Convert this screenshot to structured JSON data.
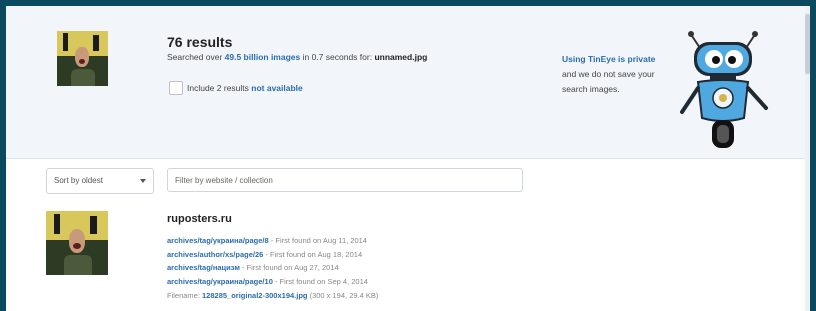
{
  "summary": {
    "results_count": "76 results",
    "searched_prefix": "Searched over ",
    "index_size": "49.5 billion images",
    "searched_mid": " in 0.7 seconds for: ",
    "query_filename": "unnamed.jpg",
    "include_prefix": "Include 2 results ",
    "not_available": "not available"
  },
  "privacy": {
    "link": "Using TinEye is private",
    "line2": "and we do not save your",
    "line3": "search images."
  },
  "controls": {
    "sort_label": "Sort by oldest",
    "filter_placeholder": "Filter by website / collection"
  },
  "result": {
    "site": "ruposters.ru",
    "matches": [
      {
        "url": "archives/tag/украина/page/8",
        "found": " - First found on Aug 11, 2014"
      },
      {
        "url": "archives/author/xs/page/26",
        "found": " - First found on Aug 18, 2014"
      },
      {
        "url": "archives/tag/нацизм",
        "found": " - First found on Aug 27, 2014"
      },
      {
        "url": "archives/tag/украина/page/10",
        "found": " - First found on Sep 4, 2014"
      }
    ],
    "filename_label": "Filename: ",
    "filename": "128285_original2-300x194.jpg",
    "filename_meta": " (300 x 194, 29.4 KB)"
  },
  "colors": {
    "accent": "#2b6cb0",
    "summary_bg": "#f2f6fb",
    "robot_blue": "#4fa9e0"
  }
}
